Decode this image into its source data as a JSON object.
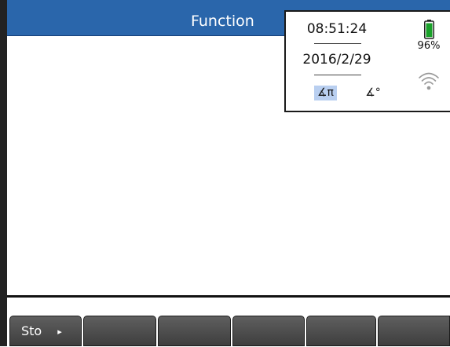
{
  "app": {
    "title": "Function"
  },
  "status": {
    "time": "08:51:24",
    "date": "2016/2/29",
    "angle_modes": {
      "radians": "∡π",
      "degrees": "∡°"
    },
    "battery_percent": "96%",
    "battery_level": 0.96,
    "battery_color": "#1aa12a",
    "wifi_icon": "wifi-icon"
  },
  "menu": {
    "keys": [
      {
        "label": "Sto",
        "arrow": "▸"
      },
      {
        "label": ""
      },
      {
        "label": ""
      },
      {
        "label": ""
      },
      {
        "label": ""
      },
      {
        "label": ""
      }
    ]
  },
  "colors": {
    "title_bar": "#2a66ab",
    "angle_selected": "#b9cff0"
  }
}
